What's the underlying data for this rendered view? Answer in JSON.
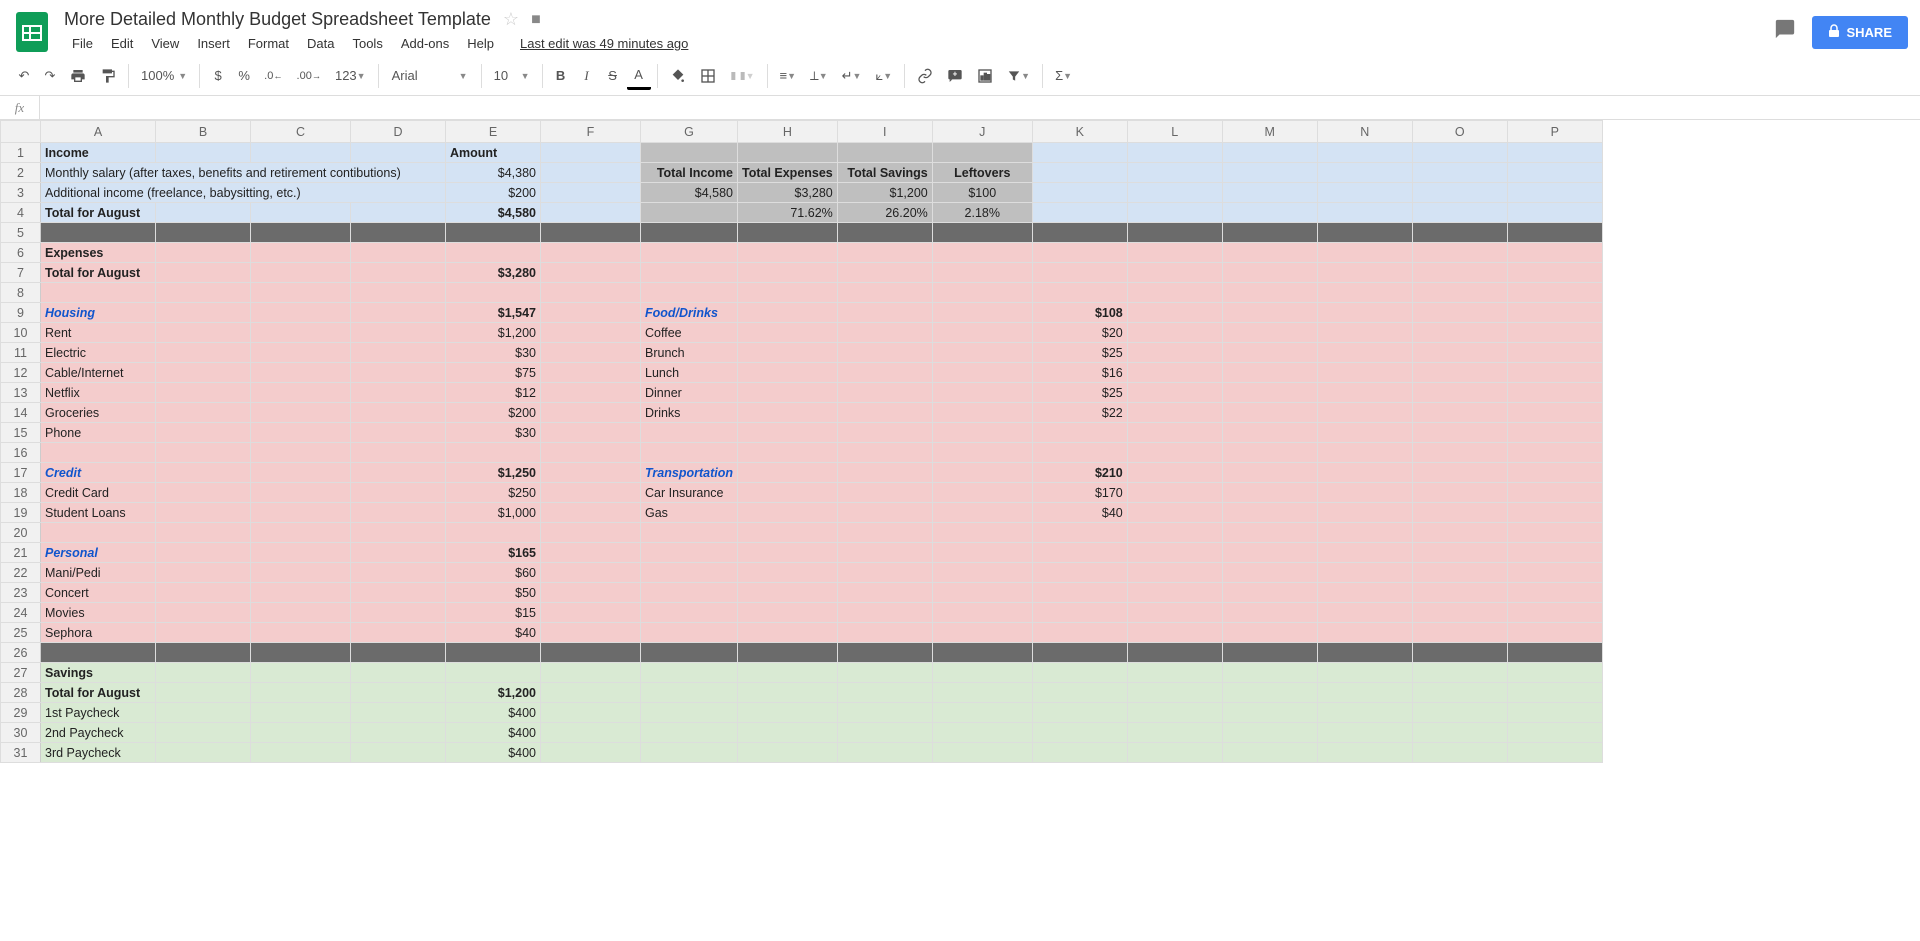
{
  "doc": {
    "title": "More Detailed Monthly Budget Spreadsheet Template",
    "last_edit": "Last edit was 49 minutes ago"
  },
  "menu": {
    "file": "File",
    "edit": "Edit",
    "view": "View",
    "insert": "Insert",
    "format": "Format",
    "data": "Data",
    "tools": "Tools",
    "addons": "Add-ons",
    "help": "Help"
  },
  "share": "SHARE",
  "toolbar": {
    "zoom": "100%",
    "font": "Arial",
    "size": "10",
    "n123": "123",
    "decdec": ".0",
    "incdec": ".00"
  },
  "columns": [
    "A",
    "B",
    "C",
    "D",
    "E",
    "F",
    "G",
    "H",
    "I",
    "J",
    "K",
    "L",
    "M",
    "N",
    "O",
    "P"
  ],
  "rows": [
    {
      "n": 1,
      "bg": "blue",
      "cells": {
        "A": {
          "t": "Income",
          "b": true
        },
        "E": {
          "t": "Amount",
          "b": true
        },
        "G": {
          "t": "",
          "bg": "gray"
        },
        "H": {
          "t": "",
          "bg": "gray"
        },
        "I": {
          "t": "",
          "bg": "gray"
        },
        "J": {
          "t": "",
          "bg": "gray"
        }
      }
    },
    {
      "n": 2,
      "bg": "blue",
      "cells": {
        "A": {
          "t": "Monthly salary (after taxes, benefits and retirement contibutions)",
          "span": 4
        },
        "E": {
          "t": "$4,380",
          "r": true
        },
        "G": {
          "t": "Total Income",
          "b": true,
          "bg": "gray",
          "r": true
        },
        "H": {
          "t": "Total Expenses",
          "b": true,
          "bg": "gray",
          "r": true
        },
        "I": {
          "t": "Total Savings",
          "b": true,
          "bg": "gray",
          "r": true
        },
        "J": {
          "t": "Leftovers",
          "b": true,
          "bg": "gray",
          "c": true
        }
      }
    },
    {
      "n": 3,
      "bg": "blue",
      "cells": {
        "A": {
          "t": "Additional income (freelance, babysitting, etc.)",
          "span": 4
        },
        "E": {
          "t": "$200",
          "r": true
        },
        "G": {
          "t": "$4,580",
          "bg": "gray",
          "r": true
        },
        "H": {
          "t": "$3,280",
          "bg": "gray",
          "r": true
        },
        "I": {
          "t": "$1,200",
          "bg": "gray",
          "r": true
        },
        "J": {
          "t": "$100",
          "bg": "gray",
          "c": true
        }
      }
    },
    {
      "n": 4,
      "bg": "blue",
      "cells": {
        "A": {
          "t": "Total for August",
          "b": true
        },
        "E": {
          "t": "$4,580",
          "b": true,
          "r": true
        },
        "G": {
          "t": "",
          "bg": "gray"
        },
        "H": {
          "t": "71.62%",
          "bg": "gray",
          "r": true
        },
        "I": {
          "t": "26.20%",
          "bg": "gray",
          "r": true
        },
        "J": {
          "t": "2.18%",
          "bg": "gray",
          "c": true
        }
      }
    },
    {
      "n": 5,
      "bg": "darkgray",
      "cells": {}
    },
    {
      "n": 6,
      "bg": "pink",
      "cells": {
        "A": {
          "t": "Expenses",
          "b": true
        }
      }
    },
    {
      "n": 7,
      "bg": "pink",
      "cells": {
        "A": {
          "t": "Total for August",
          "b": true
        },
        "E": {
          "t": "$3,280",
          "b": true,
          "r": true
        }
      }
    },
    {
      "n": 8,
      "bg": "pink",
      "cells": {}
    },
    {
      "n": 9,
      "bg": "pink",
      "cells": {
        "A": {
          "t": "Housing",
          "b": true,
          "i": true,
          "blue": true
        },
        "E": {
          "t": "$1,547",
          "b": true,
          "r": true
        },
        "G": {
          "t": "Food/Drinks",
          "b": true,
          "i": true,
          "blue": true
        },
        "K": {
          "t": "$108",
          "b": true,
          "r": true
        }
      }
    },
    {
      "n": 10,
      "bg": "pink",
      "cells": {
        "A": {
          "t": "Rent"
        },
        "E": {
          "t": "$1,200",
          "r": true
        },
        "G": {
          "t": "Coffee"
        },
        "K": {
          "t": "$20",
          "r": true
        }
      }
    },
    {
      "n": 11,
      "bg": "pink",
      "cells": {
        "A": {
          "t": "Electric"
        },
        "E": {
          "t": "$30",
          "r": true
        },
        "G": {
          "t": "Brunch"
        },
        "K": {
          "t": "$25",
          "r": true
        }
      }
    },
    {
      "n": 12,
      "bg": "pink",
      "cells": {
        "A": {
          "t": "Cable/Internet"
        },
        "E": {
          "t": "$75",
          "r": true
        },
        "G": {
          "t": "Lunch"
        },
        "K": {
          "t": "$16",
          "r": true
        }
      }
    },
    {
      "n": 13,
      "bg": "pink",
      "cells": {
        "A": {
          "t": "Netflix"
        },
        "E": {
          "t": "$12",
          "r": true
        },
        "G": {
          "t": "Dinner"
        },
        "K": {
          "t": "$25",
          "r": true
        }
      }
    },
    {
      "n": 14,
      "bg": "pink",
      "cells": {
        "A": {
          "t": "Groceries"
        },
        "E": {
          "t": "$200",
          "r": true
        },
        "G": {
          "t": "Drinks"
        },
        "K": {
          "t": "$22",
          "r": true
        }
      }
    },
    {
      "n": 15,
      "bg": "pink",
      "cells": {
        "A": {
          "t": "Phone"
        },
        "E": {
          "t": "$30",
          "r": true
        }
      }
    },
    {
      "n": 16,
      "bg": "pink",
      "cells": {}
    },
    {
      "n": 17,
      "bg": "pink",
      "cells": {
        "A": {
          "t": "Credit",
          "b": true,
          "i": true,
          "blue": true
        },
        "E": {
          "t": "$1,250",
          "b": true,
          "r": true
        },
        "G": {
          "t": "Transportation",
          "b": true,
          "i": true,
          "blue": true
        },
        "K": {
          "t": "$210",
          "b": true,
          "r": true
        }
      }
    },
    {
      "n": 18,
      "bg": "pink",
      "cells": {
        "A": {
          "t": "Credit Card"
        },
        "E": {
          "t": "$250",
          "r": true
        },
        "G": {
          "t": "Car Insurance"
        },
        "K": {
          "t": "$170",
          "r": true
        }
      }
    },
    {
      "n": 19,
      "bg": "pink",
      "cells": {
        "A": {
          "t": "Student Loans"
        },
        "E": {
          "t": "$1,000",
          "r": true
        },
        "G": {
          "t": "Gas"
        },
        "K": {
          "t": "$40",
          "r": true
        }
      }
    },
    {
      "n": 20,
      "bg": "pink",
      "cells": {}
    },
    {
      "n": 21,
      "bg": "pink",
      "cells": {
        "A": {
          "t": "Personal",
          "b": true,
          "i": true,
          "blue": true
        },
        "E": {
          "t": "$165",
          "b": true,
          "r": true
        }
      }
    },
    {
      "n": 22,
      "bg": "pink",
      "cells": {
        "A": {
          "t": "Mani/Pedi"
        },
        "E": {
          "t": "$60",
          "r": true
        }
      }
    },
    {
      "n": 23,
      "bg": "pink",
      "cells": {
        "A": {
          "t": "Concert"
        },
        "E": {
          "t": "$50",
          "r": true
        }
      }
    },
    {
      "n": 24,
      "bg": "pink",
      "cells": {
        "A": {
          "t": "Movies"
        },
        "E": {
          "t": "$15",
          "r": true
        }
      }
    },
    {
      "n": 25,
      "bg": "pink",
      "cells": {
        "A": {
          "t": "Sephora"
        },
        "E": {
          "t": "$40",
          "r": true
        }
      }
    },
    {
      "n": 26,
      "bg": "darkgray",
      "cells": {}
    },
    {
      "n": 27,
      "bg": "green",
      "cells": {
        "A": {
          "t": "Savings",
          "b": true
        }
      }
    },
    {
      "n": 28,
      "bg": "green",
      "cells": {
        "A": {
          "t": "Total for August",
          "b": true
        },
        "E": {
          "t": "$1,200",
          "b": true,
          "r": true
        }
      }
    },
    {
      "n": 29,
      "bg": "green",
      "cells": {
        "A": {
          "t": "1st Paycheck"
        },
        "E": {
          "t": "$400",
          "r": true
        }
      }
    },
    {
      "n": 30,
      "bg": "green",
      "cells": {
        "A": {
          "t": "2nd Paycheck"
        },
        "E": {
          "t": "$400",
          "r": true
        }
      }
    },
    {
      "n": 31,
      "bg": "green",
      "cells": {
        "A": {
          "t": "3rd Paycheck"
        },
        "E": {
          "t": "$400",
          "r": true
        }
      }
    }
  ]
}
